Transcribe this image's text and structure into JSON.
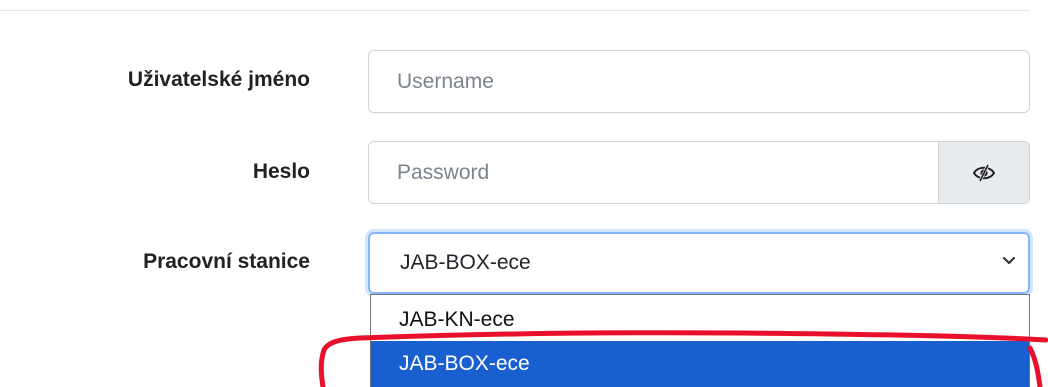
{
  "form": {
    "username": {
      "label": "Uživatelské jméno",
      "placeholder": "Username",
      "value": ""
    },
    "password": {
      "label": "Heslo",
      "placeholder": "Password",
      "value": "",
      "toggle_icon": "eye-slash-icon"
    },
    "workstation": {
      "label": "Pracovní stanice",
      "selected": "JAB-BOX-ece",
      "options": [
        "JAB-KN-ece",
        "JAB-BOX-ece"
      ],
      "highlighted_option": "JAB-BOX-ece"
    }
  },
  "colors": {
    "highlight": "#1a5fd0",
    "focus_border": "#86b7fe",
    "annotation": "#e8102a",
    "addon_bg": "#e9ecef"
  },
  "annotation": {
    "type": "hand-drawn-outline",
    "target": "JAB-BOX-ece"
  }
}
